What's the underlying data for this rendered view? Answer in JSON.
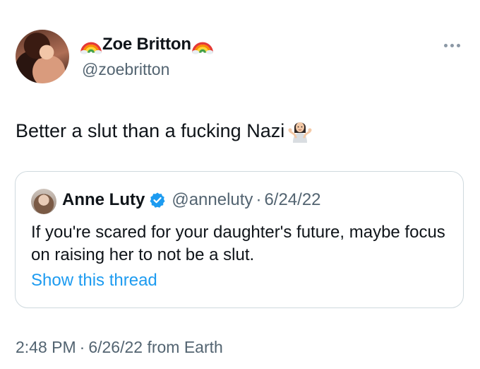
{
  "author": {
    "display_name": "Zoe Britton",
    "handle": "@zoebritton",
    "name_emoji": "rainbow-icon"
  },
  "tweet": {
    "text": "Better a slut than a fucking Nazi",
    "emoji": "person-shrugging-icon"
  },
  "quote": {
    "display_name": "Anne Luty",
    "handle": "@anneluty",
    "separator": "·",
    "date": "6/24/22",
    "text": "If you're scared for your daughter's future, maybe focus on raising her to not be a slut.",
    "link": "Show this thread",
    "verified_icon": "verified-badge-icon"
  },
  "meta": {
    "time": "2:48 PM",
    "separator": "·",
    "date_source": "6/26/22 from Earth"
  },
  "colors": {
    "text": "#0f1419",
    "secondary": "#536471",
    "link": "#1d9bf0",
    "border": "#cfd9de"
  }
}
